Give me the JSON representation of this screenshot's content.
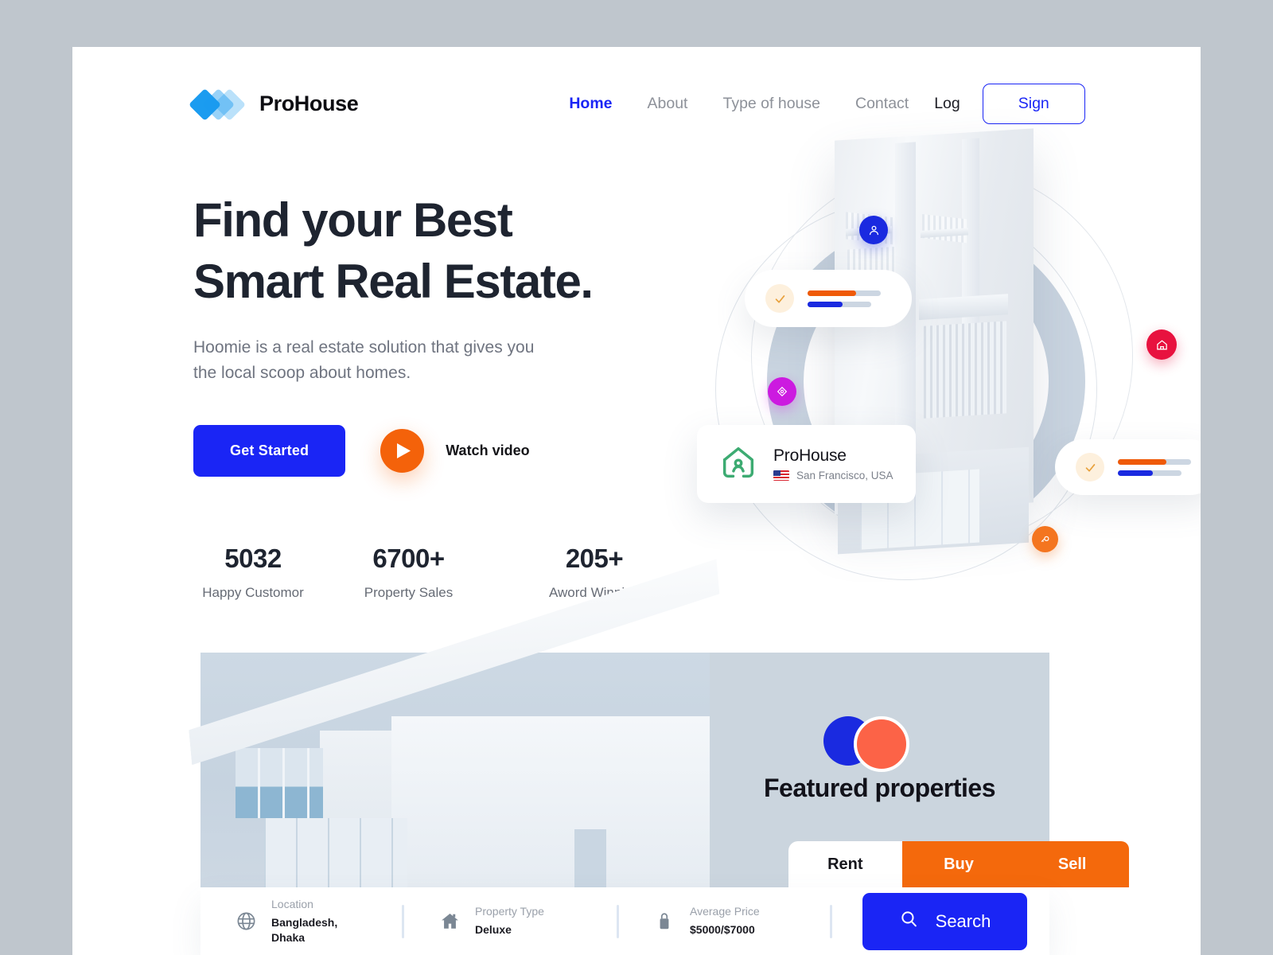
{
  "brand": {
    "name": "ProHouse",
    "logo_icon": "diamond-stack-logo"
  },
  "nav": {
    "links": [
      {
        "label": "Home",
        "active": true
      },
      {
        "label": "About",
        "active": false
      },
      {
        "label": "Type of house",
        "active": false
      },
      {
        "label": "Contact",
        "active": false
      }
    ],
    "log_label": "Log",
    "sign_label": "Sign"
  },
  "hero": {
    "headline_line1": "Find your Best",
    "headline_line2": "Smart Real Estate.",
    "subtitle": "Hoomie is a real estate solution that gives you the local scoop about homes.",
    "primary_cta": "Get Started",
    "video_label": "Watch video",
    "stats": [
      {
        "value": "5032",
        "label": "Happy Customor"
      },
      {
        "value": "6700+",
        "label": "Property Sales"
      },
      {
        "value": "205+",
        "label": "Aword Winning"
      }
    ]
  },
  "hero_cards": {
    "prohouse": {
      "title": "ProHouse",
      "location": "San Francisco, USA",
      "icon": "house-user-icon",
      "flag": "us-flag-icon"
    },
    "progress_card_1": {
      "check_icon": "check-icon",
      "bar_orange_pct": 66,
      "bar_blue_pct": 55
    },
    "progress_card_2": {
      "check_icon": "check-icon",
      "bar_orange_pct": 66,
      "bar_blue_pct": 55
    },
    "badges": [
      {
        "name": "agent-badge",
        "color": "#1a2ae0"
      },
      {
        "name": "house-badge",
        "color": "#e8123f"
      },
      {
        "name": "tag-badge",
        "color": "#cc1ae0"
      },
      {
        "name": "key-badge",
        "color": "#f4751f"
      }
    ]
  },
  "featured": {
    "title": "Featured properties",
    "tabs": [
      {
        "label": "Rent",
        "active": true
      },
      {
        "label": "Buy",
        "active": false
      },
      {
        "label": "Sell",
        "active": false
      }
    ],
    "search": {
      "fields": [
        {
          "icon": "globe-icon",
          "label": "Location",
          "value": "Bangladesh, Dhaka"
        },
        {
          "icon": "home-icon",
          "label": "Property Type",
          "value": "Deluxe"
        },
        {
          "icon": "price-tag-icon",
          "label": "Average Price",
          "value": "$5000/$7000"
        }
      ],
      "button_label": "Search",
      "button_icon": "search-icon"
    }
  },
  "colors": {
    "primary_blue": "#1a25f5",
    "accent_orange": "#f4620a",
    "tab_orange": "#f4690c",
    "coral": "#fc6347",
    "page_bg": "#bfc6cd",
    "headline": "#1e2430"
  }
}
